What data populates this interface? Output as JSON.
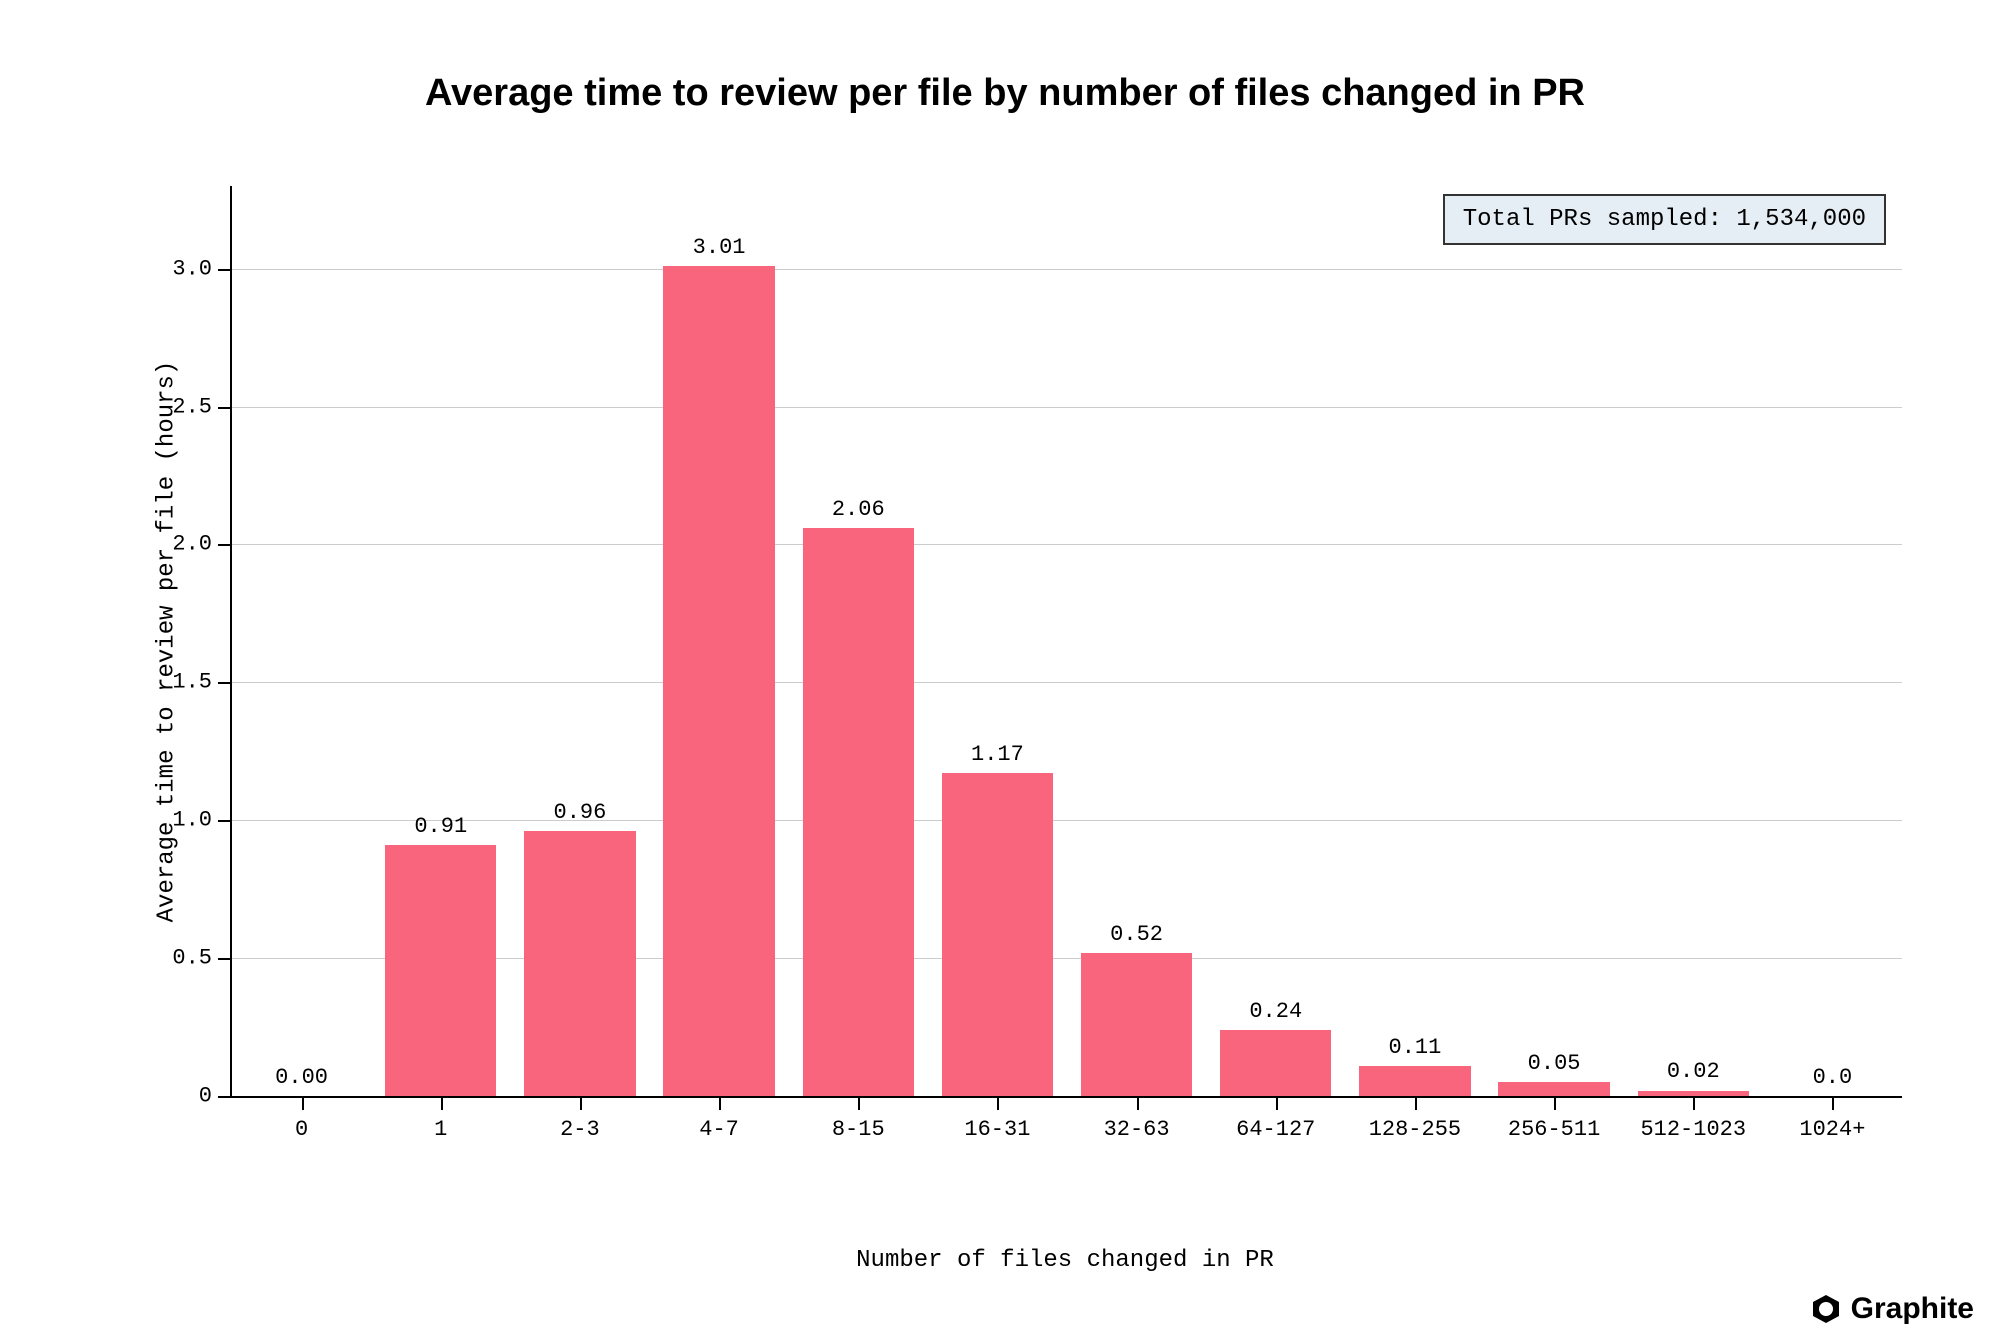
{
  "chart_data": {
    "type": "bar",
    "title": "Average time to review per file by number of files changed in PR",
    "xlabel": "Number of files changed in PR",
    "ylabel": "Average time to review per file (hours)",
    "categories": [
      "0",
      "1",
      "2-3",
      "4-7",
      "8-15",
      "16-31",
      "32-63",
      "64-127",
      "128-255",
      "256-511",
      "512-1023",
      "1024+"
    ],
    "values": [
      0.0,
      0.91,
      0.96,
      3.01,
      2.06,
      1.17,
      0.52,
      0.24,
      0.11,
      0.05,
      0.02,
      0.0
    ],
    "bar_labels": [
      "0.00",
      "0.91",
      "0.96",
      "3.01",
      "2.06",
      "1.17",
      "0.52",
      "0.24",
      "0.11",
      "0.05",
      "0.02",
      "0.0"
    ],
    "y_ticks": [
      0,
      0.5,
      1.0,
      1.5,
      2.0,
      2.5,
      3.0
    ],
    "y_tick_labels": [
      "0",
      "0.5",
      "1.0",
      "1.5",
      "2.0",
      "2.5",
      "3.0"
    ],
    "ylim": [
      0,
      3.3
    ],
    "annotation": "Total PRs sampled: 1,534,000",
    "bar_color": "#f9657c"
  },
  "brand": {
    "name": "Graphite"
  }
}
